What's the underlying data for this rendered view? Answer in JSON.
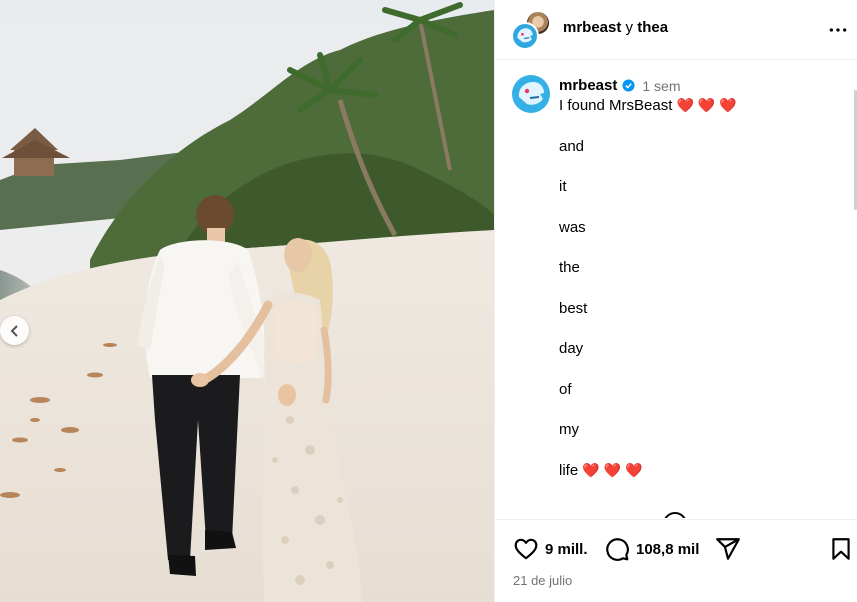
{
  "post": {
    "header": {
      "author_primary": "mrbeast",
      "joiner": "y",
      "author_secondary": "thea",
      "more_icon": "more-horizontal-icon"
    },
    "caption": {
      "username": "mrbeast",
      "verified": true,
      "time_ago": "1 sem",
      "lines": [
        {
          "text": "I found MrsBeast",
          "hearts": "❤️ ❤️ ❤️"
        },
        {
          "text": "and",
          "hearts": ""
        },
        {
          "text": "it",
          "hearts": ""
        },
        {
          "text": "was",
          "hearts": ""
        },
        {
          "text": "the",
          "hearts": ""
        },
        {
          "text": "best",
          "hearts": ""
        },
        {
          "text": "day",
          "hearts": ""
        },
        {
          "text": "of",
          "hearts": ""
        },
        {
          "text": "my",
          "hearts": ""
        },
        {
          "text": "life",
          "hearts": "❤️ ❤️ ❤️"
        }
      ]
    },
    "actions": {
      "likes": "9 mill.",
      "comments": "108,8 mil",
      "like_icon": "heart-icon",
      "comment_icon": "comment-icon",
      "share_icon": "share-icon",
      "save_icon": "bookmark-icon"
    },
    "date": "21 de julio"
  },
  "colors": {
    "heart": "#ff3a6e",
    "verified": "#0095f6",
    "secondary_text": "#737373",
    "divider": "#efefef"
  }
}
